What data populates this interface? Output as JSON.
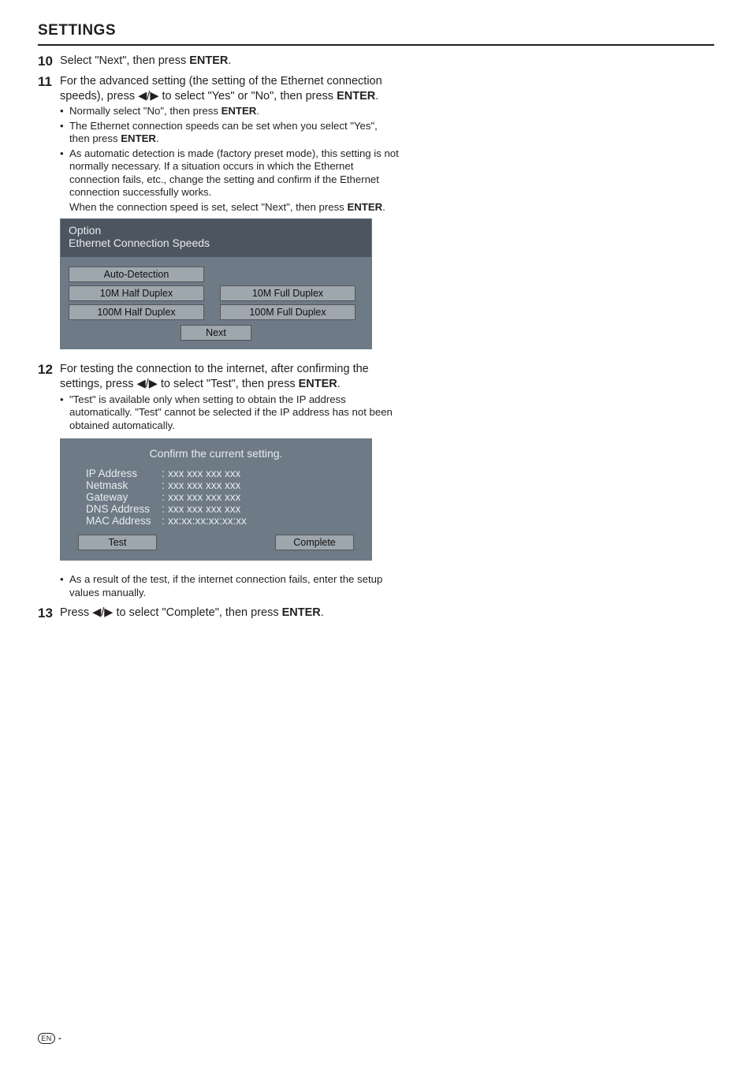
{
  "heading": "SETTINGS",
  "steps": {
    "s10": {
      "num": "10",
      "text_a": "Select \"Next\", then press ",
      "text_b": "ENTER",
      "text_c": "."
    },
    "s11": {
      "num": "11",
      "l1": "For the advanced setting (the setting of the Ethernet connection speeds), press ",
      "tri": "◀/▶",
      "l2": " to select \"Yes\" or \"No\", then press ",
      "enter": "ENTER",
      "l3": ".",
      "b1a": "Normally select \"No\", then press ",
      "b1b": "ENTER",
      "b1c": ".",
      "b2a": "The Ethernet connection speeds can be set when you select \"Yes\", then press ",
      "b2b": "ENTER",
      "b2c": ".",
      "b3": "As automatic detection is made (factory preset mode), this setting is not normally necessary. If a situation occurs in which the Ethernet connection fails, etc., change the setting and confirm if the Ethernet connection successfully works.",
      "b3after_a": "When the connection speed is set, select \"Next\", then press ",
      "b3after_b": "ENTER",
      "b3after_c": "."
    },
    "s12": {
      "num": "12",
      "l1": "For testing the connection to the internet, after confirming the settings, press ",
      "tri": "◀/▶",
      "l2": " to select \"Test\", then press ",
      "enter": "ENTER",
      "l3": ".",
      "b1": "\"Test\" is available only when setting to obtain the IP address automatically. \"Test\" cannot be selected if the IP address has not been obtained automatically.",
      "b2": "As a result of the test, if the internet connection fails, enter the setup values manually."
    },
    "s13": {
      "num": "13",
      "l1": "Press ",
      "tri": "◀/▶",
      "l2": " to select \"Complete\", then press ",
      "enter": "ENTER",
      "l3": "."
    }
  },
  "panel1": {
    "title1": "Option",
    "title2": "Ethernet Connection Speeds",
    "buttons": {
      "auto": "Auto-Detection",
      "h10": "10M Half Duplex",
      "f10": "10M Full Duplex",
      "h100": "100M Half Duplex",
      "f100": "100M Full Duplex",
      "next": "Next"
    }
  },
  "panel2": {
    "title": "Confirm the current setting.",
    "rows": {
      "ip_k": "IP Address",
      "ip_v": "xxx xxx xxx xxx",
      "nm_k": "Netmask",
      "nm_v": "xxx xxx xxx xxx",
      "gw_k": "Gateway",
      "gw_v": "xxx xxx xxx xxx",
      "dns_k": "DNS Address",
      "dns_v": "xxx xxx xxx xxx",
      "mac_k": "MAC Address",
      "mac_v": "xx:xx:xx:xx:xx:xx"
    },
    "test": "Test",
    "complete": "Complete"
  },
  "footer": {
    "en": "EN",
    "dash": "-"
  }
}
